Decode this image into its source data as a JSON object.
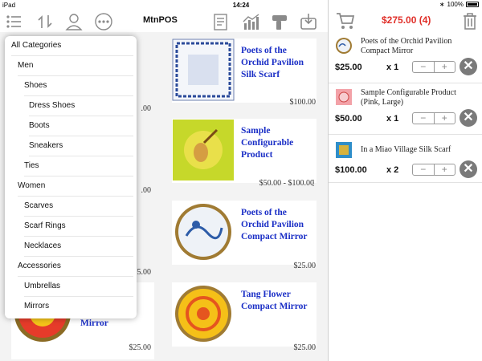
{
  "status_bar": {
    "device": "iPad",
    "time": "14:24",
    "battery": "100%"
  },
  "toolbar": {
    "title": "MtnPOS",
    "icons": [
      "list-icon",
      "sync-icon",
      "user-icon",
      "more-icon",
      "report-icon",
      "chart-icon",
      "scanner-icon",
      "inbox-icon"
    ]
  },
  "cart_header": {
    "total": "$275.00 (4)"
  },
  "products": [
    {
      "name": "Poets of the Orchid Pavilion Silk Scarf",
      "price": "$100.00"
    },
    {
      "name": "Sample Configurable Product",
      "price": "$50.00 - $100.00"
    },
    {
      "name": "Poets of the Orchid Pavilion Compact Mirror",
      "price": "$25.00"
    },
    {
      "name": "Tang Flower Compact Mirror",
      "price": "$25.00"
    }
  ],
  "left_products": [
    {
      "price": ".00"
    },
    {
      "price": ".00"
    },
    {
      "price": ".5.00"
    },
    {
      "name": "Mirror",
      "price": "$25.00"
    }
  ],
  "cart": [
    {
      "name": "Poets of the Orchid Pavilion Compact Mirror",
      "price": "$25.00",
      "qty": "x 1"
    },
    {
      "name": "Sample Configurable Product (Pink, Large)",
      "price": "$50.00",
      "qty": "x 1"
    },
    {
      "name": "In a Miao Village Silk Scarf",
      "price": "$100.00",
      "qty": "x 2"
    }
  ],
  "stepper": {
    "minus": "−",
    "plus": "+"
  },
  "remove_label": "✕",
  "categories": [
    {
      "label": "All Categories",
      "level": 0
    },
    {
      "label": "Men",
      "level": 1
    },
    {
      "label": "Shoes",
      "level": 2
    },
    {
      "label": "Dress Shoes",
      "level": 3
    },
    {
      "label": "Boots",
      "level": 3
    },
    {
      "label": "Sneakers",
      "level": 3
    },
    {
      "label": "Ties",
      "level": 2
    },
    {
      "label": "Women",
      "level": 1
    },
    {
      "label": "Scarves",
      "level": 2
    },
    {
      "label": "Scarf Rings",
      "level": 2
    },
    {
      "label": "Necklaces",
      "level": 2
    },
    {
      "label": "Accessories",
      "level": 1
    },
    {
      "label": "Umbrellas",
      "level": 2
    },
    {
      "label": "Mirrors",
      "level": 2
    }
  ],
  "colors": {
    "accent": "#e0302a",
    "product_link": "#1b2fc6"
  }
}
